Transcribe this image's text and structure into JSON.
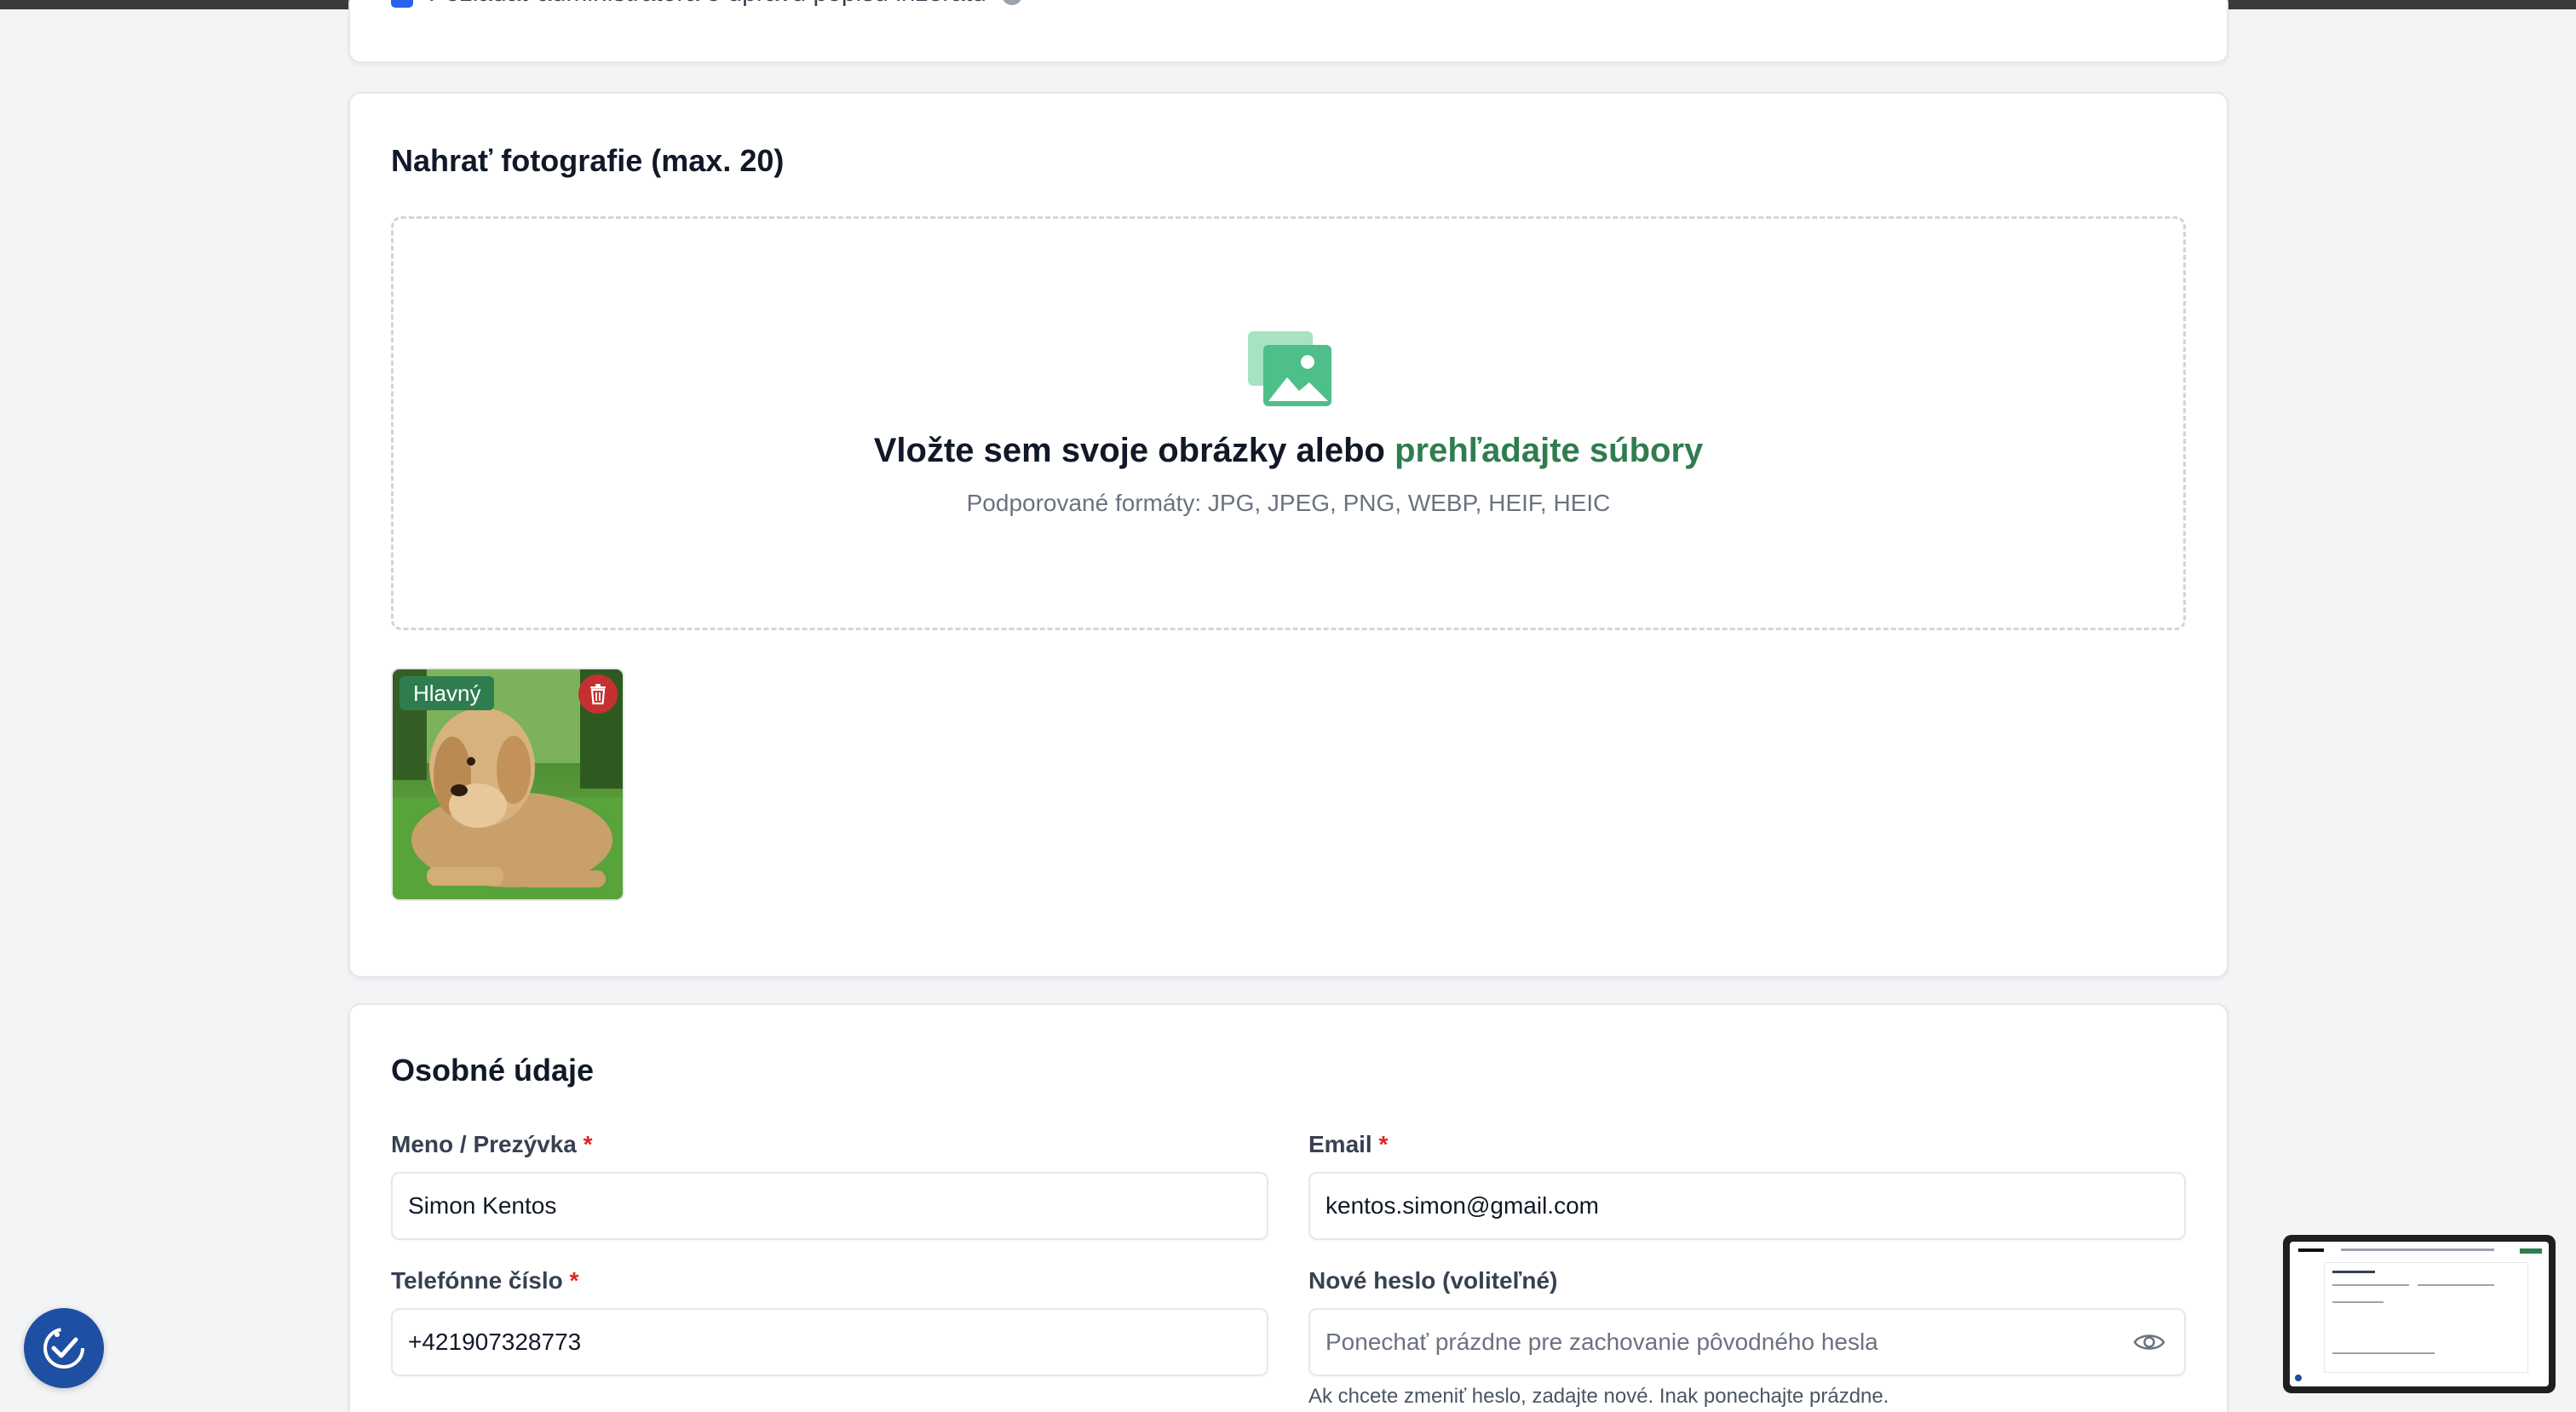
{
  "previous_section": {
    "checkbox_label": "Požiadať administrátora o úpravu popisu inzerátu"
  },
  "photos": {
    "title": "Nahrať fotografie (max. 20)",
    "dropzone": {
      "text": "Vložte sem svoje obrázky alebo",
      "browse_link": "prehľadajte súbory",
      "formats": "Podporované formáty: JPG, JPEG, PNG, WEBP, HEIF, HEIC"
    },
    "thumbnails": [
      {
        "badge": "Hlavný"
      }
    ]
  },
  "personal": {
    "title": "Osobné údaje",
    "fields": {
      "name": {
        "label": "Meno / Prezývka",
        "required_mark": "*",
        "value": "Simon Kentos"
      },
      "email": {
        "label": "Email",
        "required_mark": "*",
        "value": "kentos.simon@gmail.com"
      },
      "phone": {
        "label": "Telefónne číslo",
        "required_mark": "*",
        "value": "+421907328773"
      },
      "password": {
        "label": "Nové heslo (voliteľné)",
        "placeholder": "Ponechať prázdne pre zachovanie pôvodného hesla",
        "hint": "Ak chcete zmeniť heslo, zadajte nové. Inak ponechajte prázdne."
      }
    }
  },
  "colors": {
    "accent_green": "#2f7d4f",
    "delete_red": "#c53030",
    "required_red": "#dc2626",
    "accessibility_blue": "#1e4fa3"
  }
}
